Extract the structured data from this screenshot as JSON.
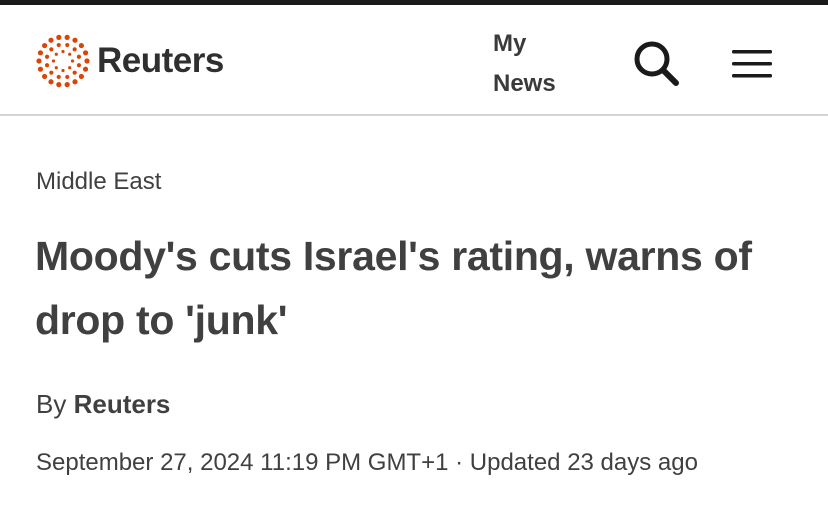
{
  "header": {
    "logo_text": "Reuters",
    "logo_color": "#dc4405",
    "my_news_line1": "My",
    "my_news_line2": "News",
    "search_icon": "search-icon",
    "menu_icon": "hamburger-menu-icon"
  },
  "article": {
    "section": "Middle East",
    "headline": "Moody's cuts Israel's rating, warns of drop to 'junk'",
    "byline_prefix": "By",
    "byline_author": "Reuters",
    "dateline": "September 27, 2024 11:19 PM GMT+1 · Updated 23 days ago"
  }
}
